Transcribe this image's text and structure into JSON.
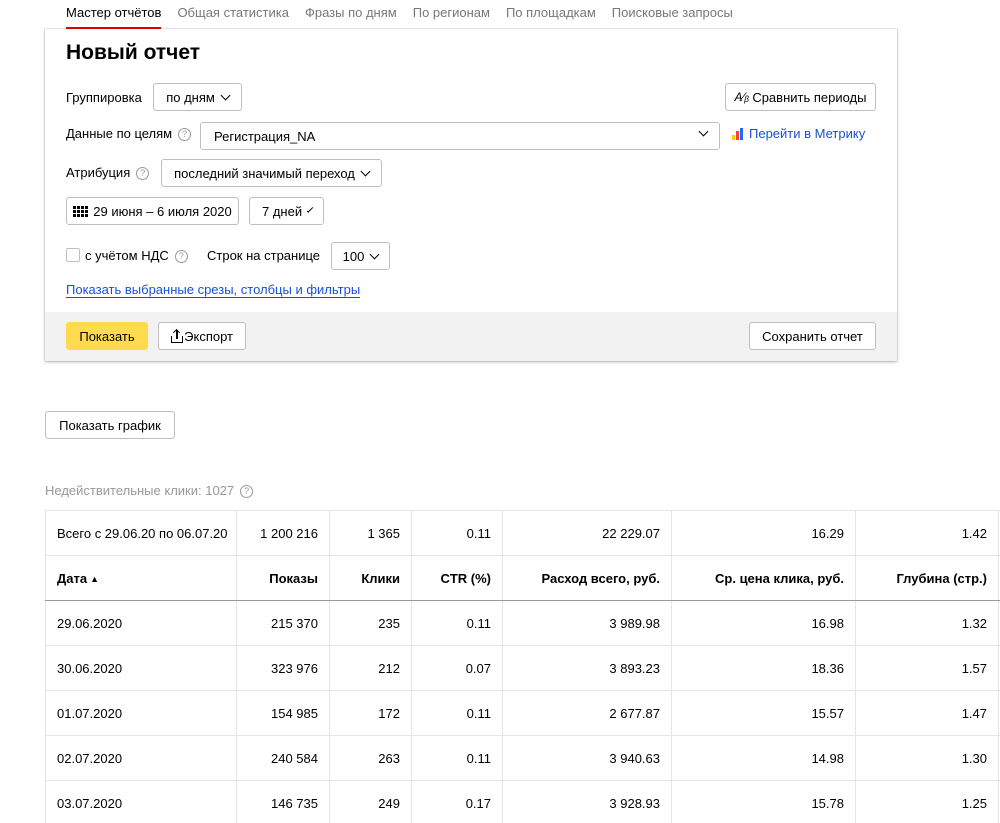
{
  "tabs": [
    "Мастер отчётов",
    "Общая статистика",
    "Фразы по дням",
    "По регионам",
    "По площадкам",
    "Поисковые запросы"
  ],
  "report": {
    "title": "Новый отчет",
    "grouping_label": "Группировка",
    "grouping_value": "по дням",
    "compare_label": "Сравнить периоды",
    "goals_label": "Данные по целям",
    "goals_value": "Регистрация_NA",
    "metrika_link": "Перейти в Метрику",
    "attribution_label": "Атрибуция",
    "attribution_value": "последний значимый переход",
    "date_range": "29 июня – 6 июля 2020",
    "period_value": "7 дней",
    "vat_label": "с учётом НДС",
    "vat_checked": false,
    "rows_label": "Строк на странице",
    "rows_value": "100",
    "show_filters_link": "Показать выбранные срезы, столбцы и фильтры",
    "show_button": "Показать",
    "export_button": "Экспорт",
    "save_button": "Сохранить отчет"
  },
  "chart_button": "Показать график",
  "invalid_clicks": "Недействительные клики: 1027",
  "table": {
    "total": [
      "Всего с 29.06.20 по 06.07.20",
      "1 200 216",
      "1 365",
      "0.11",
      "22 229.07",
      "16.29",
      "1.42"
    ],
    "columns": [
      "Дата",
      "Показы",
      "Клики",
      "CTR (%)",
      "Расход всего, руб.",
      "Ср. цена клика, руб.",
      "Глубина (стр.)"
    ],
    "sort_indicator": "▲",
    "rows": [
      [
        "29.06.2020",
        "215 370",
        "235",
        "0.11",
        "3 989.98",
        "16.98",
        "1.32"
      ],
      [
        "30.06.2020",
        "323 976",
        "212",
        "0.07",
        "3 893.23",
        "18.36",
        "1.57"
      ],
      [
        "01.07.2020",
        "154 985",
        "172",
        "0.11",
        "2 677.87",
        "15.57",
        "1.47"
      ],
      [
        "02.07.2020",
        "240 584",
        "263",
        "0.11",
        "3 940.63",
        "14.98",
        "1.30"
      ],
      [
        "03.07.2020",
        "146 735",
        "249",
        "0.17",
        "3 928.93",
        "15.78",
        "1.25"
      ]
    ]
  },
  "colors": {
    "accent_yellow": "#ffdb4d",
    "link_blue": "#1a4ed8",
    "active_tab_underline": "#e60000"
  },
  "icons": [
    "compare-icon",
    "metrika-icon",
    "calendar-icon",
    "help-icon",
    "export-icon",
    "chevron-down-icon",
    "sort-asc-icon"
  ]
}
